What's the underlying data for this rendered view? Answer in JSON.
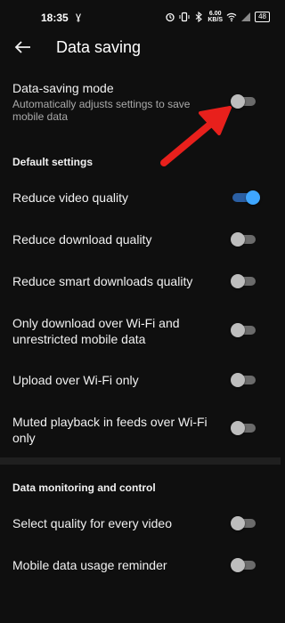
{
  "status_bar": {
    "time": "18:35",
    "app_indicator": "ɣ",
    "speed": "6.00",
    "speed_unit": "KB/S",
    "battery": "48",
    "icons": [
      "alarm-icon",
      "vibrate-icon",
      "bluetooth-icon",
      "wifi-icon",
      "signal-icon",
      "battery-icon"
    ]
  },
  "header": {
    "title": "Data saving"
  },
  "data_saving_mode": {
    "label": "Data-saving mode",
    "description": "Automatically adjusts settings to save mobile data",
    "enabled": false
  },
  "default_settings": {
    "heading": "Default settings",
    "items": [
      {
        "label": "Reduce video quality",
        "enabled": true
      },
      {
        "label": "Reduce download quality",
        "enabled": false
      },
      {
        "label": "Reduce smart downloads quality",
        "enabled": false
      },
      {
        "label": "Only download over Wi-Fi and unrestricted mobile data",
        "enabled": false
      },
      {
        "label": "Upload over Wi-Fi only",
        "enabled": false
      },
      {
        "label": "Muted playback in feeds over Wi-Fi only",
        "enabled": false
      }
    ]
  },
  "monitoring": {
    "heading": "Data monitoring and control",
    "items": [
      {
        "label": "Select quality for every video",
        "enabled": false
      },
      {
        "label": "Mobile data usage reminder",
        "enabled": false
      }
    ]
  },
  "colors": {
    "background": "#0f0f0f",
    "toggle_on": "#3ea6ff",
    "annotation_arrow": "#e8201c"
  }
}
